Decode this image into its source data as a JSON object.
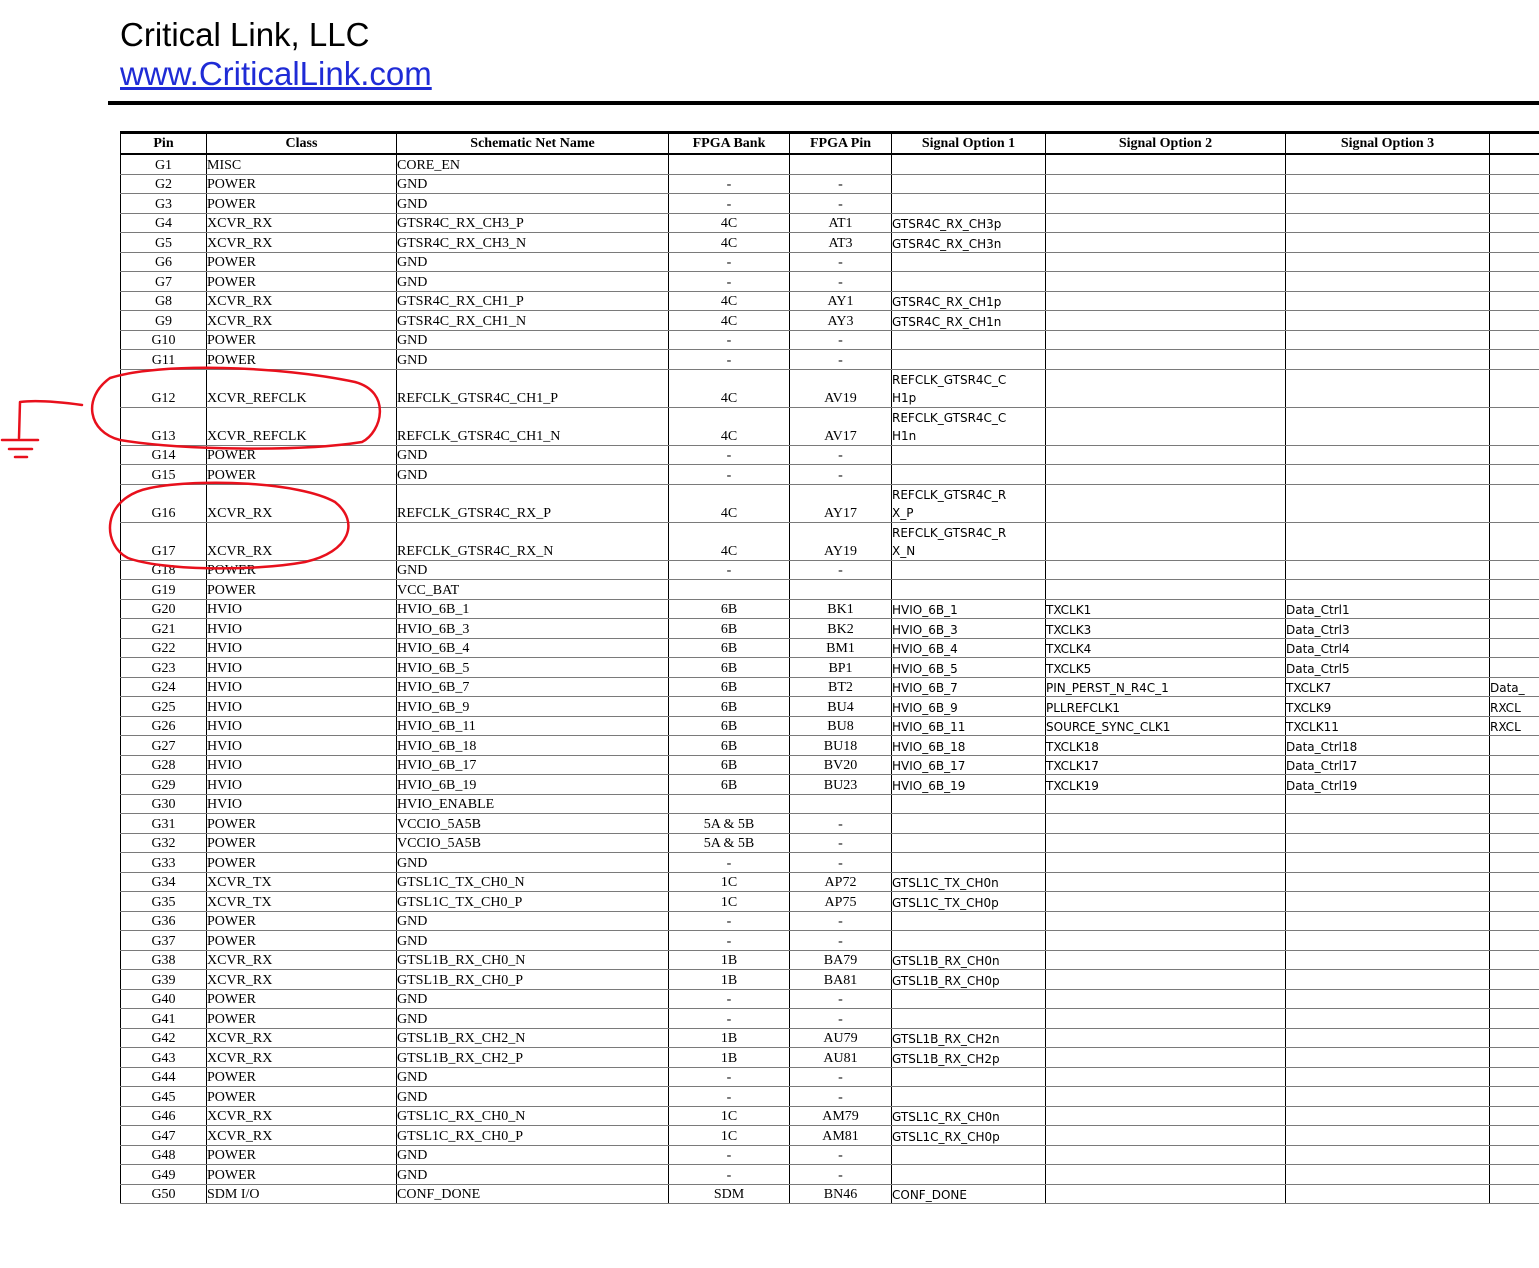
{
  "header": {
    "company": "Critical Link, LLC",
    "website": "www.CriticalLink.com"
  },
  "table": {
    "columns": [
      "Pin",
      "Class",
      "Schematic Net Name",
      "FPGA Bank",
      "FPGA Pin",
      "Signal Option 1",
      "Signal Option 2",
      "Signal Option 3",
      ""
    ],
    "rows": [
      [
        "G1",
        "MISC",
        "CORE_EN",
        "",
        "",
        "",
        "",
        "",
        ""
      ],
      [
        "G2",
        "POWER",
        "GND",
        "-",
        "-",
        "",
        "",
        "",
        ""
      ],
      [
        "G3",
        "POWER",
        "GND",
        "-",
        "-",
        "",
        "",
        "",
        ""
      ],
      [
        "G4",
        "XCVR_RX",
        "GTSR4C_RX_CH3_P",
        "4C",
        "AT1",
        "GTSR4C_RX_CH3p",
        "",
        "",
        ""
      ],
      [
        "G5",
        "XCVR_RX",
        "GTSR4C_RX_CH3_N",
        "4C",
        "AT3",
        "GTSR4C_RX_CH3n",
        "",
        "",
        ""
      ],
      [
        "G6",
        "POWER",
        "GND",
        "-",
        "-",
        "",
        "",
        "",
        ""
      ],
      [
        "G7",
        "POWER",
        "GND",
        "-",
        "-",
        "",
        "",
        "",
        ""
      ],
      [
        "G8",
        "XCVR_RX",
        "GTSR4C_RX_CH1_P",
        "4C",
        "AY1",
        "GTSR4C_RX_CH1p",
        "",
        "",
        ""
      ],
      [
        "G9",
        "XCVR_RX",
        "GTSR4C_RX_CH1_N",
        "4C",
        "AY3",
        "GTSR4C_RX_CH1n",
        "",
        "",
        ""
      ],
      [
        "G10",
        "POWER",
        "GND",
        "-",
        "-",
        "",
        "",
        "",
        ""
      ],
      [
        "G11",
        "POWER",
        "GND",
        "-",
        "-",
        "",
        "",
        "",
        ""
      ],
      [
        "G12",
        "XCVR_REFCLK",
        "REFCLK_GTSR4C_CH1_P",
        "4C",
        "AV19",
        "REFCLK_GTSR4C_C\nH1p",
        "",
        "",
        ""
      ],
      [
        "G13",
        "XCVR_REFCLK",
        "REFCLK_GTSR4C_CH1_N",
        "4C",
        "AV17",
        "REFCLK_GTSR4C_C\nH1n",
        "",
        "",
        ""
      ],
      [
        "G14",
        "POWER",
        "GND",
        "-",
        "-",
        "",
        "",
        "",
        ""
      ],
      [
        "G15",
        "POWER",
        "GND",
        "-",
        "-",
        "",
        "",
        "",
        ""
      ],
      [
        "G16",
        "XCVR_RX",
        "REFCLK_GTSR4C_RX_P",
        "4C",
        "AY17",
        "REFCLK_GTSR4C_R\nX_P",
        "",
        "",
        ""
      ],
      [
        "G17",
        "XCVR_RX",
        "REFCLK_GTSR4C_RX_N",
        "4C",
        "AY19",
        "REFCLK_GTSR4C_R\nX_N",
        "",
        "",
        ""
      ],
      [
        "G18",
        "POWER",
        "GND",
        "-",
        "-",
        "",
        "",
        "",
        ""
      ],
      [
        "G19",
        "POWER",
        "VCC_BAT",
        "",
        "",
        "",
        "",
        "",
        ""
      ],
      [
        "G20",
        "HVIO",
        "HVIO_6B_1",
        "6B",
        "BK1",
        "HVIO_6B_1",
        "TXCLK1",
        "Data_Ctrl1",
        ""
      ],
      [
        "G21",
        "HVIO",
        "HVIO_6B_3",
        "6B",
        "BK2",
        "HVIO_6B_3",
        "TXCLK3",
        "Data_Ctrl3",
        ""
      ],
      [
        "G22",
        "HVIO",
        "HVIO_6B_4",
        "6B",
        "BM1",
        "HVIO_6B_4",
        "TXCLK4",
        "Data_Ctrl4",
        ""
      ],
      [
        "G23",
        "HVIO",
        "HVIO_6B_5",
        "6B",
        "BP1",
        "HVIO_6B_5",
        "TXCLK5",
        "Data_Ctrl5",
        ""
      ],
      [
        "G24",
        "HVIO",
        "HVIO_6B_7",
        "6B",
        "BT2",
        "HVIO_6B_7",
        "PIN_PERST_N_R4C_1",
        "TXCLK7",
        "Data_"
      ],
      [
        "G25",
        "HVIO",
        "HVIO_6B_9",
        "6B",
        "BU4",
        "HVIO_6B_9",
        "PLLREFCLK1",
        "TXCLK9",
        "RXCL"
      ],
      [
        "G26",
        "HVIO",
        "HVIO_6B_11",
        "6B",
        "BU8",
        "HVIO_6B_11",
        "SOURCE_SYNC_CLK1",
        "TXCLK11",
        "RXCL"
      ],
      [
        "G27",
        "HVIO",
        "HVIO_6B_18",
        "6B",
        "BU18",
        "HVIO_6B_18",
        "TXCLK18",
        "Data_Ctrl18",
        ""
      ],
      [
        "G28",
        "HVIO",
        "HVIO_6B_17",
        "6B",
        "BV20",
        "HVIO_6B_17",
        "TXCLK17",
        "Data_Ctrl17",
        ""
      ],
      [
        "G29",
        "HVIO",
        "HVIO_6B_19",
        "6B",
        "BU23",
        "HVIO_6B_19",
        "TXCLK19",
        "Data_Ctrl19",
        ""
      ],
      [
        "G30",
        "HVIO",
        "HVIO_ENABLE",
        "",
        "",
        "",
        "",
        "",
        ""
      ],
      [
        "G31",
        "POWER",
        "VCCIO_5A5B",
        "5A & 5B",
        "-",
        "",
        "",
        "",
        ""
      ],
      [
        "G32",
        "POWER",
        "VCCIO_5A5B",
        "5A & 5B",
        "-",
        "",
        "",
        "",
        ""
      ],
      [
        "G33",
        "POWER",
        "GND",
        "-",
        "-",
        "",
        "",
        "",
        ""
      ],
      [
        "G34",
        "XCVR_TX",
        "GTSL1C_TX_CH0_N",
        "1C",
        "AP72",
        "GTSL1C_TX_CH0n",
        "",
        "",
        ""
      ],
      [
        "G35",
        "XCVR_TX",
        "GTSL1C_TX_CH0_P",
        "1C",
        "AP75",
        "GTSL1C_TX_CH0p",
        "",
        "",
        ""
      ],
      [
        "G36",
        "POWER",
        "GND",
        "-",
        "-",
        "",
        "",
        "",
        ""
      ],
      [
        "G37",
        "POWER",
        "GND",
        "-",
        "-",
        "",
        "",
        "",
        ""
      ],
      [
        "G38",
        "XCVR_RX",
        "GTSL1B_RX_CH0_N",
        "1B",
        "BA79",
        "GTSL1B_RX_CH0n",
        "",
        "",
        ""
      ],
      [
        "G39",
        "XCVR_RX",
        "GTSL1B_RX_CH0_P",
        "1B",
        "BA81",
        "GTSL1B_RX_CH0p",
        "",
        "",
        ""
      ],
      [
        "G40",
        "POWER",
        "GND",
        "-",
        "-",
        "",
        "",
        "",
        ""
      ],
      [
        "G41",
        "POWER",
        "GND",
        "-",
        "-",
        "",
        "",
        "",
        ""
      ],
      [
        "G42",
        "XCVR_RX",
        "GTSL1B_RX_CH2_N",
        "1B",
        "AU79",
        "GTSL1B_RX_CH2n",
        "",
        "",
        ""
      ],
      [
        "G43",
        "XCVR_RX",
        "GTSL1B_RX_CH2_P",
        "1B",
        "AU81",
        "GTSL1B_RX_CH2p",
        "",
        "",
        ""
      ],
      [
        "G44",
        "POWER",
        "GND",
        "-",
        "-",
        "",
        "",
        "",
        ""
      ],
      [
        "G45",
        "POWER",
        "GND",
        "-",
        "-",
        "",
        "",
        "",
        ""
      ],
      [
        "G46",
        "XCVR_RX",
        "GTSL1C_RX_CH0_N",
        "1C",
        "AM79",
        "GTSL1C_RX_CH0n",
        "",
        "",
        ""
      ],
      [
        "G47",
        "XCVR_RX",
        "GTSL1C_RX_CH0_P",
        "1C",
        "AM81",
        "GTSL1C_RX_CH0p",
        "",
        "",
        ""
      ],
      [
        "G48",
        "POWER",
        "GND",
        "-",
        "-",
        "",
        "",
        "",
        ""
      ],
      [
        "G49",
        "POWER",
        "GND",
        "-",
        "-",
        "",
        "",
        "",
        ""
      ],
      [
        "G50",
        "SDM I/O",
        "CONF_DONE",
        "SDM",
        "BN46",
        "CONF_DONE",
        "",
        "",
        ""
      ]
    ]
  },
  "annotations": {
    "ink_color": "#e8101c"
  }
}
